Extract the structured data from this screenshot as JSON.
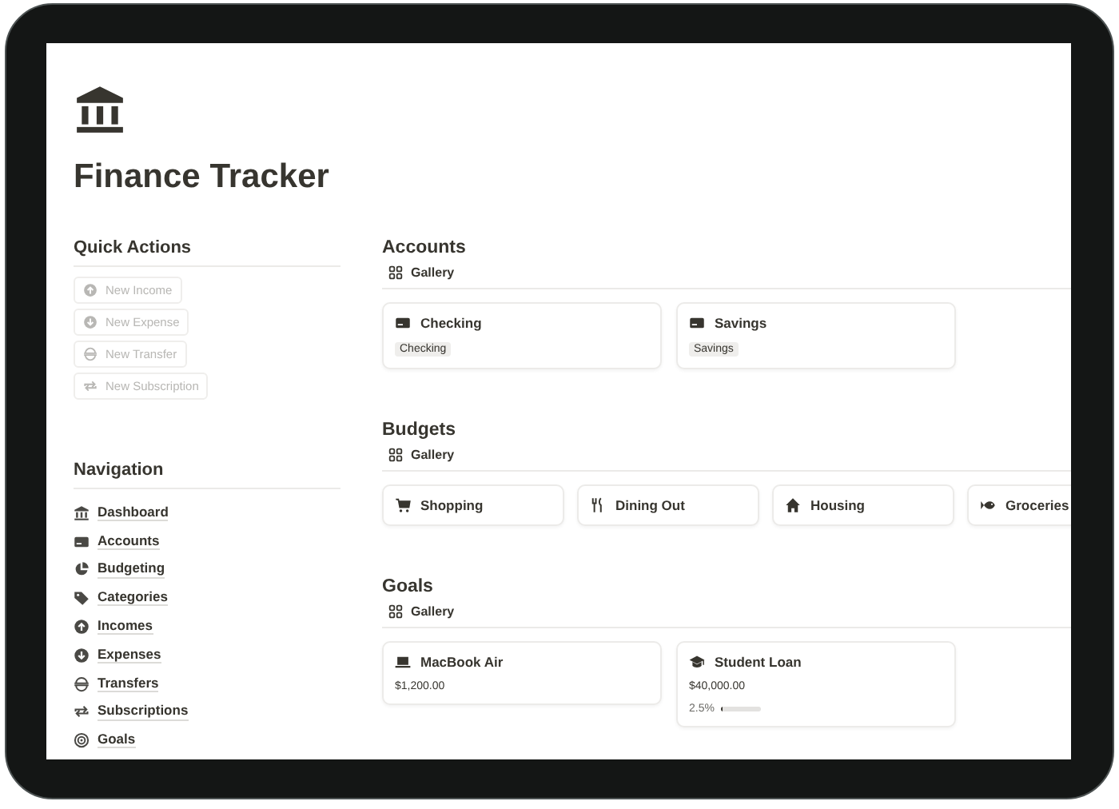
{
  "page": {
    "title": "Finance Tracker"
  },
  "quick_actions": {
    "title": "Quick Actions",
    "buttons": [
      {
        "label": "New Income",
        "disabled": true
      },
      {
        "label": "New Expense",
        "disabled": true
      },
      {
        "label": "New Transfer",
        "disabled": true
      },
      {
        "label": "New Subscription",
        "disabled": true
      }
    ]
  },
  "navigation": {
    "title": "Navigation",
    "items": [
      "Dashboard",
      "Accounts",
      "Budgeting",
      "Categories",
      "Incomes",
      "Expenses",
      "Transfers",
      "Subscriptions",
      "Goals"
    ]
  },
  "accounts": {
    "title": "Accounts",
    "view": "Gallery",
    "cards": [
      {
        "title": "Checking",
        "tag": "Checking"
      },
      {
        "title": "Savings",
        "tag": "Savings"
      }
    ]
  },
  "budgets": {
    "title": "Budgets",
    "view": "Gallery",
    "cards": [
      {
        "title": "Shopping"
      },
      {
        "title": "Dining Out"
      },
      {
        "title": "Housing"
      },
      {
        "title": "Groceries"
      }
    ]
  },
  "goals": {
    "title": "Goals",
    "view": "Gallery",
    "cards": [
      {
        "title": "MacBook Air",
        "amount": "$1,200.00"
      },
      {
        "title": "Student Loan",
        "amount": "$40,000.00",
        "progress": {
          "reading": "2.5%",
          "level": 0.025
        }
      }
    ]
  }
}
